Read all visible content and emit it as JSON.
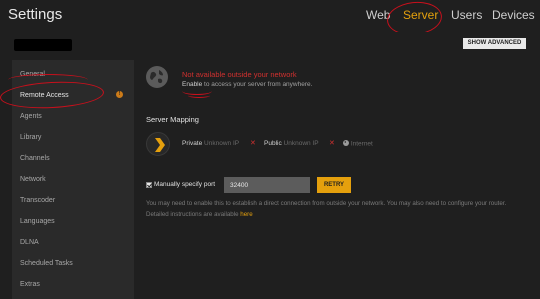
{
  "header": {
    "title": "Settings",
    "tabs": [
      {
        "label": "Web"
      },
      {
        "label": "Server",
        "active": true
      },
      {
        "label": "Users"
      },
      {
        "label": "Devices"
      }
    ]
  },
  "subbar": {
    "show_advanced_label": "SHOW ADVANCED"
  },
  "sidebar": {
    "items": [
      {
        "label": "General"
      },
      {
        "label": "Remote Access",
        "active": true,
        "warning": "!"
      },
      {
        "label": "Agents"
      },
      {
        "label": "Library"
      },
      {
        "label": "Channels"
      },
      {
        "label": "Network"
      },
      {
        "label": "Transcoder"
      },
      {
        "label": "Languages"
      },
      {
        "label": "DLNA"
      },
      {
        "label": "Scheduled Tasks"
      },
      {
        "label": "Extras"
      }
    ]
  },
  "remote_access": {
    "status_title": "Not available outside your network",
    "enable_link": "Enable",
    "status_rest": " to access your server from anywhere.",
    "mapping_title": "Server Mapping",
    "private_label": "Private",
    "private_value": "Unknown IP",
    "public_label": "Public",
    "public_value": "Unknown IP",
    "internet_label": "Internet",
    "x_mark": "✕",
    "manual_port_label": "Manually specify port",
    "manual_port_checked": true,
    "port_value": "32400",
    "retry_label": "RETRY",
    "help_text": "You may need to enable this to establish a direct connection from outside your network. You may also need to configure your router. Detailed instructions are available ",
    "help_link": "here"
  },
  "colors": {
    "accent": "#e5a00d",
    "error": "#d0302f",
    "annotation": "#c8101c"
  }
}
